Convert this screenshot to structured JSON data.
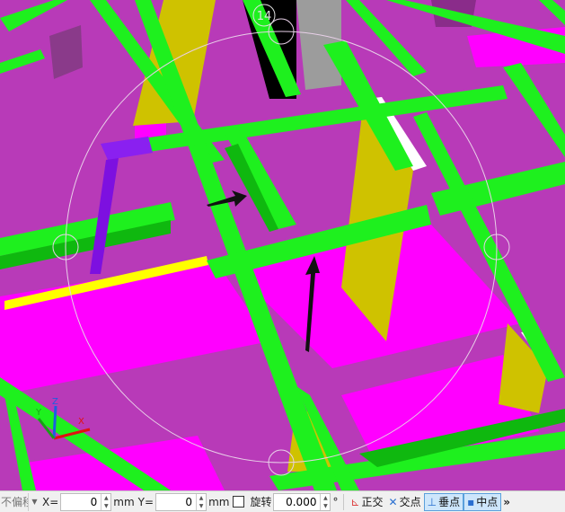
{
  "viewport": {
    "grip_number": "14",
    "axes": {
      "x_label": "X",
      "y_label": "Y",
      "z_label": "Z"
    },
    "colors": {
      "floor": "#b83ab8",
      "beam": "#1ef01e",
      "beam_shade": "#0fb80f",
      "column": "#cfc200",
      "slab_highlight": "#ff00ff",
      "rebar": "#ffff00",
      "pillar": "#7d10e0"
    }
  },
  "statusbar": {
    "offset_label": "不偏移",
    "x_label": "X=",
    "x_value": "0",
    "x_unit": "mm",
    "y_label": "Y=",
    "y_value": "0",
    "y_unit": "mm",
    "rotate_label": "旋转",
    "angle_value": "0.000",
    "angle_unit": "°",
    "ortho_label": "正交",
    "intersect_label": "交点",
    "perpendicular_label": "垂点",
    "midpoint_label": "中点",
    "more_label": "»"
  }
}
